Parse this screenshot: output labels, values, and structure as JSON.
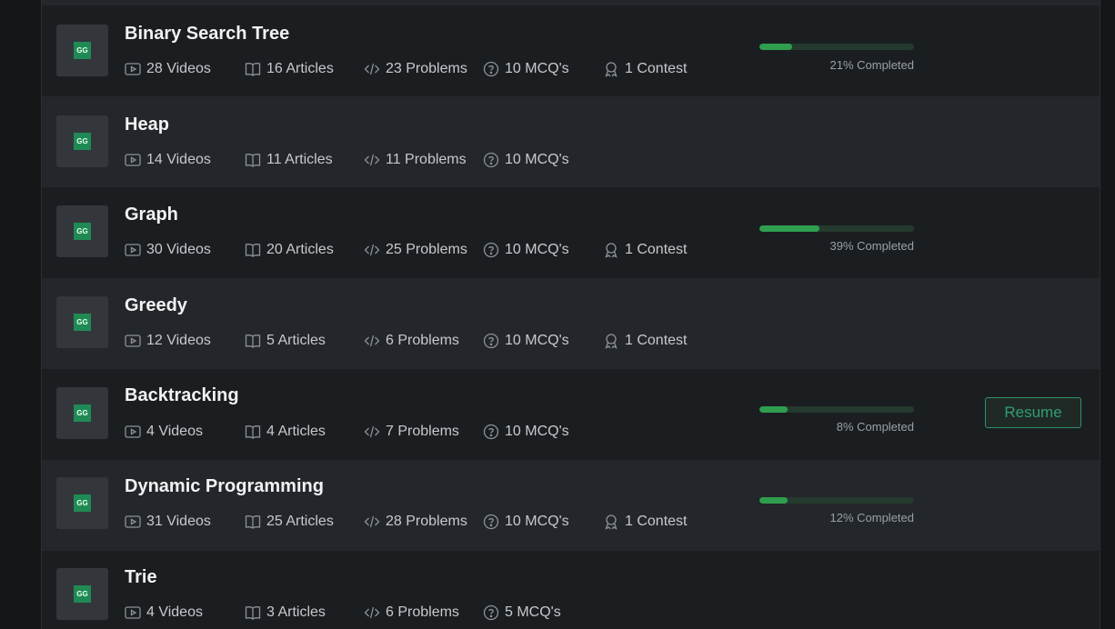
{
  "colors": {
    "accent": "#2f9e4f",
    "resume": "#2f9e6f"
  },
  "icons": {
    "thumbnail": "gfg-logo-icon",
    "videos": "play-icon",
    "articles": "book-icon",
    "problems": "code-icon",
    "mcq": "question-circle-icon",
    "contest": "award-icon"
  },
  "thumbnail_logo_text": "GG",
  "courses": [
    {
      "title": "Binary Search Tree",
      "videos": "28 Videos",
      "articles": "16 Articles",
      "problems": "23 Problems",
      "mcq": "10 MCQ's",
      "contest": "1 Contest",
      "progress": 21,
      "progress_label": "21% Completed"
    },
    {
      "title": "Heap",
      "videos": "14 Videos",
      "articles": "11 Articles",
      "problems": "11 Problems",
      "mcq": "10 MCQ's"
    },
    {
      "title": "Graph",
      "videos": "30 Videos",
      "articles": "20 Articles",
      "problems": "25 Problems",
      "mcq": "10 MCQ's",
      "contest": "1 Contest",
      "progress": 39,
      "progress_label": "39% Completed"
    },
    {
      "title": "Greedy",
      "videos": "12 Videos",
      "articles": "5 Articles",
      "problems": "6 Problems",
      "mcq": "10 MCQ's",
      "contest": "1 Contest"
    },
    {
      "title": "Backtracking",
      "videos": "4 Videos",
      "articles": "4 Articles",
      "problems": "7 Problems",
      "mcq": "10 MCQ's",
      "progress": 8,
      "progress_label": "8% Completed",
      "resume": "Resume"
    },
    {
      "title": "Dynamic Programming",
      "videos": "31 Videos",
      "articles": "25 Articles",
      "problems": "28 Problems",
      "mcq": "10 MCQ's",
      "contest": "1 Contest",
      "progress": 12,
      "progress_label": "12% Completed"
    },
    {
      "title": "Trie",
      "videos": "4 Videos",
      "articles": "3 Articles",
      "problems": "6 Problems",
      "mcq": "5 MCQ's"
    }
  ]
}
